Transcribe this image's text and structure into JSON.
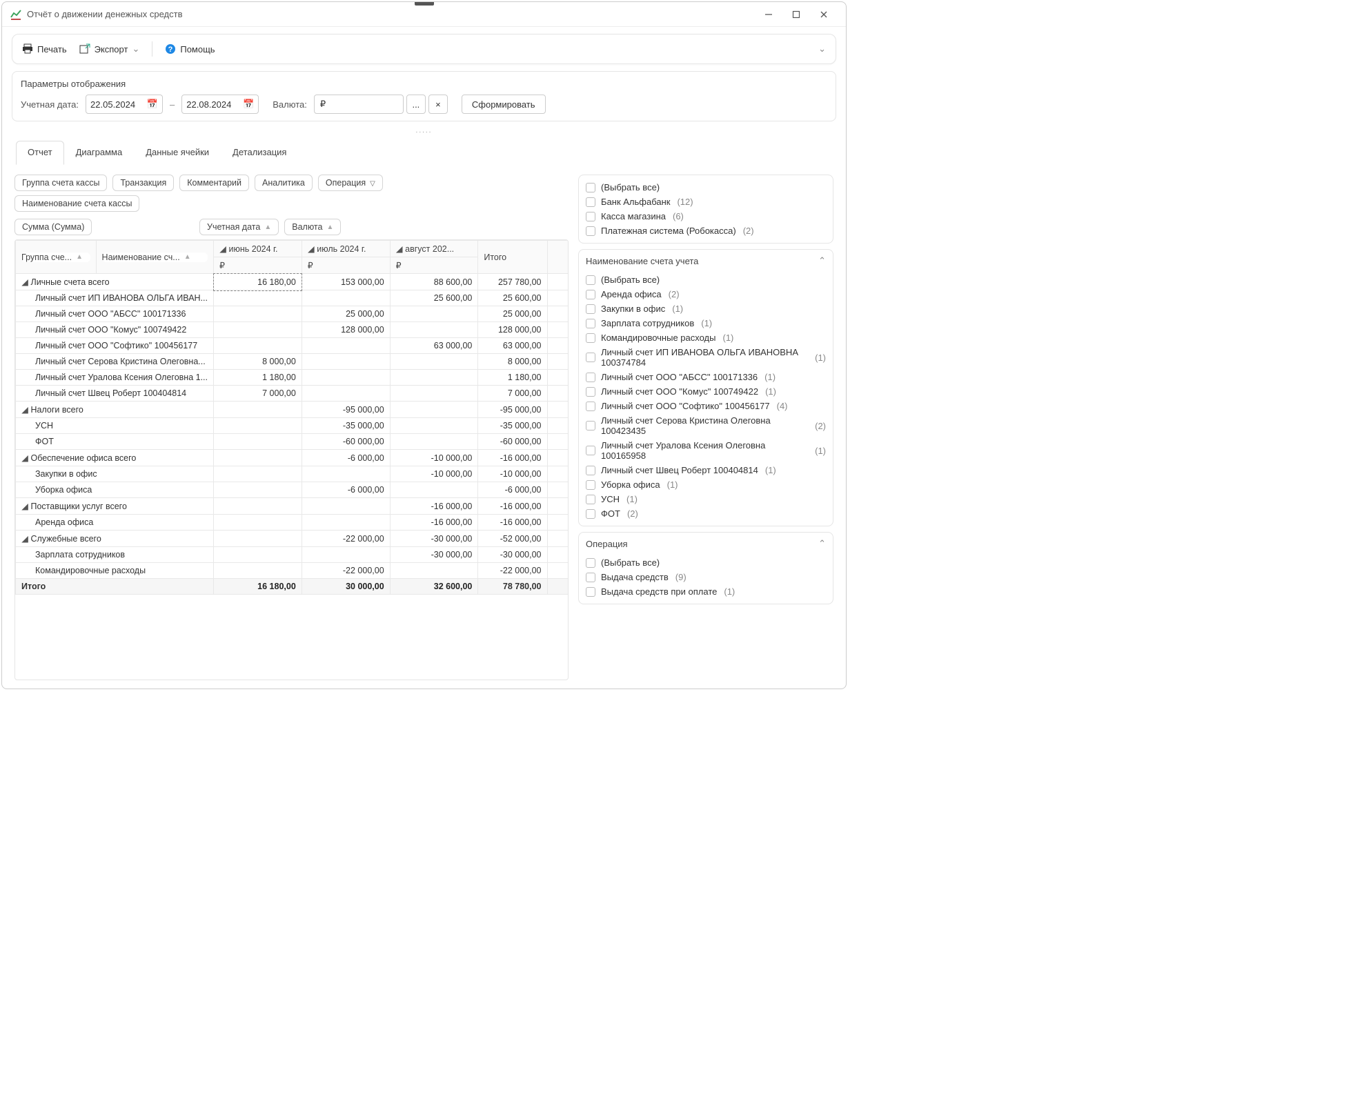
{
  "window": {
    "title": "Отчёт о движении денежных средств"
  },
  "toolbar": {
    "print": "Печать",
    "export": "Экспорт",
    "help": "Помощь"
  },
  "params": {
    "title": "Параметры отображения",
    "acctDateLabel": "Учетная дата:",
    "dateFrom": "22.05.2024",
    "dateTo": "22.08.2024",
    "currencyLabel": "Валюта:",
    "currencyValue": "₽",
    "dots": "...",
    "clear": "×",
    "submit": "Сформировать"
  },
  "tabs": {
    "t0": "Отчет",
    "t1": "Диаграмма",
    "t2": "Данные ячейки",
    "t3": "Детализация"
  },
  "pills": {
    "group": "Группа счета кассы",
    "tx": "Транзакция",
    "comment": "Комментарий",
    "analytics": "Аналитика",
    "op": "Операция",
    "accName": "Наименование счета кассы",
    "sum": "Сумма (Сумма)",
    "acctDate": "Учетная дата",
    "currency": "Валюта",
    "groupCol": "Группа сче...",
    "nameCol": "Наименование сч..."
  },
  "months": {
    "m1": "июнь 2024 г.",
    "m2": "июль 2024 г.",
    "m3": "август 202...",
    "total": "Итого",
    "cur": "₽"
  },
  "rows": [
    {
      "lvl": 0,
      "caret": true,
      "label": "Личные счета всего",
      "v": [
        "16 180,00",
        "153 000,00",
        "88 600,00",
        "257 780,00"
      ],
      "first_dashed": true
    },
    {
      "lvl": 1,
      "label": "Личный счет ИП ИВАНОВА ОЛЬГА ИВАН...",
      "v": [
        "",
        "",
        "25 600,00",
        "25 600,00"
      ]
    },
    {
      "lvl": 1,
      "label": "Личный счет ООО \"АБСС\" 100171336",
      "v": [
        "",
        "25 000,00",
        "",
        "25 000,00"
      ]
    },
    {
      "lvl": 1,
      "label": "Личный счет ООО \"Комус\" 100749422",
      "v": [
        "",
        "128 000,00",
        "",
        "128 000,00"
      ]
    },
    {
      "lvl": 1,
      "label": "Личный счет ООО \"Софтико\" 100456177",
      "v": [
        "",
        "",
        "63 000,00",
        "63 000,00"
      ]
    },
    {
      "lvl": 1,
      "label": "Личный счет Серова Кристина Олеговна...",
      "v": [
        "8 000,00",
        "",
        "",
        "8 000,00"
      ]
    },
    {
      "lvl": 1,
      "label": "Личный счет Уралова Ксения Олеговна 1...",
      "v": [
        "1 180,00",
        "",
        "",
        "1 180,00"
      ]
    },
    {
      "lvl": 1,
      "label": "Личный счет Швец Роберт 100404814",
      "v": [
        "7 000,00",
        "",
        "",
        "7 000,00"
      ]
    },
    {
      "lvl": 0,
      "caret": true,
      "label": "Налоги всего",
      "v": [
        "",
        "-95 000,00",
        "",
        "-95 000,00"
      ]
    },
    {
      "lvl": 1,
      "label": "УСН",
      "v": [
        "",
        "-35 000,00",
        "",
        "-35 000,00"
      ]
    },
    {
      "lvl": 1,
      "label": "ФОТ",
      "v": [
        "",
        "-60 000,00",
        "",
        "-60 000,00"
      ]
    },
    {
      "lvl": 0,
      "caret": true,
      "label": "Обеспечение офиса всего",
      "v": [
        "",
        "-6 000,00",
        "-10 000,00",
        "-16 000,00"
      ]
    },
    {
      "lvl": 1,
      "label": "Закупки в офис",
      "v": [
        "",
        "",
        "-10 000,00",
        "-10 000,00"
      ]
    },
    {
      "lvl": 1,
      "label": "Уборка офиса",
      "v": [
        "",
        "-6 000,00",
        "",
        "-6 000,00"
      ]
    },
    {
      "lvl": 0,
      "caret": true,
      "label": "Поставщики услуг всего",
      "v": [
        "",
        "",
        "-16 000,00",
        "-16 000,00"
      ]
    },
    {
      "lvl": 1,
      "label": "Аренда офиса",
      "v": [
        "",
        "",
        "-16 000,00",
        "-16 000,00"
      ]
    },
    {
      "lvl": 0,
      "caret": true,
      "label": "Служебные всего",
      "v": [
        "",
        "-22 000,00",
        "-30 000,00",
        "-52 000,00"
      ]
    },
    {
      "lvl": 1,
      "label": "Зарплата сотрудников",
      "v": [
        "",
        "",
        "-30 000,00",
        "-30 000,00"
      ]
    },
    {
      "lvl": 1,
      "label": "Командировочные расходы",
      "v": [
        "",
        "-22 000,00",
        "",
        "-22 000,00"
      ]
    }
  ],
  "totalRow": {
    "label": "Итого",
    "v": [
      "16 180,00",
      "30 000,00",
      "32 600,00",
      "78 780,00"
    ],
    "colors": [
      "red",
      "green",
      "green",
      ""
    ]
  },
  "filterTop": {
    "items": [
      {
        "label": "(Выбрать все)"
      },
      {
        "label": "Банк Альфабанк",
        "count": "(12)"
      },
      {
        "label": "Касса магазина",
        "count": "(6)"
      },
      {
        "label": "Платежная система (Робокасса)",
        "count": "(2)"
      }
    ]
  },
  "filterAcct": {
    "title": "Наименование счета учета",
    "items": [
      {
        "label": "(Выбрать все)"
      },
      {
        "label": "Аренда офиса",
        "count": "(2)"
      },
      {
        "label": "Закупки в офис",
        "count": "(1)"
      },
      {
        "label": "Зарплата сотрудников",
        "count": "(1)"
      },
      {
        "label": "Командировочные расходы",
        "count": "(1)"
      },
      {
        "label": "Личный счет ИП ИВАНОВА ОЛЬГА ИВАНОВНА 100374784",
        "count": "(1)"
      },
      {
        "label": "Личный счет ООО \"АБСС\" 100171336",
        "count": "(1)"
      },
      {
        "label": "Личный счет ООО \"Комус\" 100749422",
        "count": "(1)"
      },
      {
        "label": "Личный счет ООО \"Софтико\" 100456177",
        "count": "(4)"
      },
      {
        "label": "Личный счет Серова Кристина Олеговна 100423435",
        "count": "(2)"
      },
      {
        "label": "Личный счет Уралова Ксения Олеговна 100165958",
        "count": "(1)"
      },
      {
        "label": "Личный счет Швец Роберт 100404814",
        "count": "(1)"
      },
      {
        "label": "Уборка офиса",
        "count": "(1)"
      },
      {
        "label": "УСН",
        "count": "(1)"
      },
      {
        "label": "ФОТ",
        "count": "(2)"
      }
    ]
  },
  "filterOp": {
    "title": "Операция",
    "items": [
      {
        "label": "(Выбрать все)"
      },
      {
        "label": "Выдача средств",
        "count": "(9)"
      },
      {
        "label": "Выдача средств при оплате",
        "count": "(1)"
      }
    ]
  }
}
